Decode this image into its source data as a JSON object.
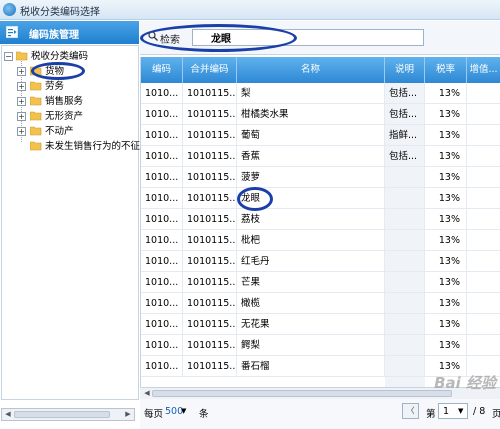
{
  "window": {
    "title": "税收分类编码选择"
  },
  "left_panel": {
    "title": "编码族管理"
  },
  "tree": {
    "root": "税收分类编码",
    "items": [
      {
        "label": "货物"
      },
      {
        "label": "劳务"
      },
      {
        "label": "销售服务"
      },
      {
        "label": "无形资产"
      },
      {
        "label": "不动产"
      },
      {
        "label": "未发生销售行为的不征"
      }
    ]
  },
  "search": {
    "label": "检索",
    "value": "龙眼"
  },
  "grid": {
    "columns": [
      "编码",
      "合并编码",
      "名称",
      "说明",
      "税率",
      "增值..."
    ],
    "rows": [
      {
        "code": "1010...",
        "merge": "1010115...",
        "name": "梨",
        "desc": "包括...",
        "rate": "13%"
      },
      {
        "code": "1010...",
        "merge": "1010115...",
        "name": "柑橘类水果",
        "desc": "包括...",
        "rate": "13%"
      },
      {
        "code": "1010...",
        "merge": "1010115...",
        "name": "葡萄",
        "desc": "指鲜...",
        "rate": "13%"
      },
      {
        "code": "1010...",
        "merge": "1010115...",
        "name": "香蕉",
        "desc": "包括...",
        "rate": "13%"
      },
      {
        "code": "1010...",
        "merge": "1010115...",
        "name": "菠萝",
        "desc": "",
        "rate": "13%"
      },
      {
        "code": "1010...",
        "merge": "1010115...",
        "name": "龙眼",
        "desc": "",
        "rate": "13%"
      },
      {
        "code": "1010...",
        "merge": "1010115...",
        "name": "荔枝",
        "desc": "",
        "rate": "13%"
      },
      {
        "code": "1010...",
        "merge": "1010115...",
        "name": "枇杷",
        "desc": "",
        "rate": "13%"
      },
      {
        "code": "1010...",
        "merge": "1010115...",
        "name": "红毛丹",
        "desc": "",
        "rate": "13%"
      },
      {
        "code": "1010...",
        "merge": "1010115...",
        "name": "芒果",
        "desc": "",
        "rate": "13%"
      },
      {
        "code": "1010...",
        "merge": "1010115...",
        "name": "橄榄",
        "desc": "",
        "rate": "13%"
      },
      {
        "code": "1010...",
        "merge": "1010115...",
        "name": "无花果",
        "desc": "",
        "rate": "13%"
      },
      {
        "code": "1010...",
        "merge": "1010115...",
        "name": "鳄梨",
        "desc": "",
        "rate": "13%"
      },
      {
        "code": "1010...",
        "merge": "1010115...",
        "name": "番石榴",
        "desc": "",
        "rate": "13%"
      }
    ]
  },
  "pager": {
    "per_page_label": "每页",
    "per_page_value": "500",
    "per_page_unit": "条",
    "page_prefix": "第",
    "page_value": "1",
    "total_pages": "/ 8",
    "page_suffix": "页"
  },
  "watermark": "Bai 经验"
}
